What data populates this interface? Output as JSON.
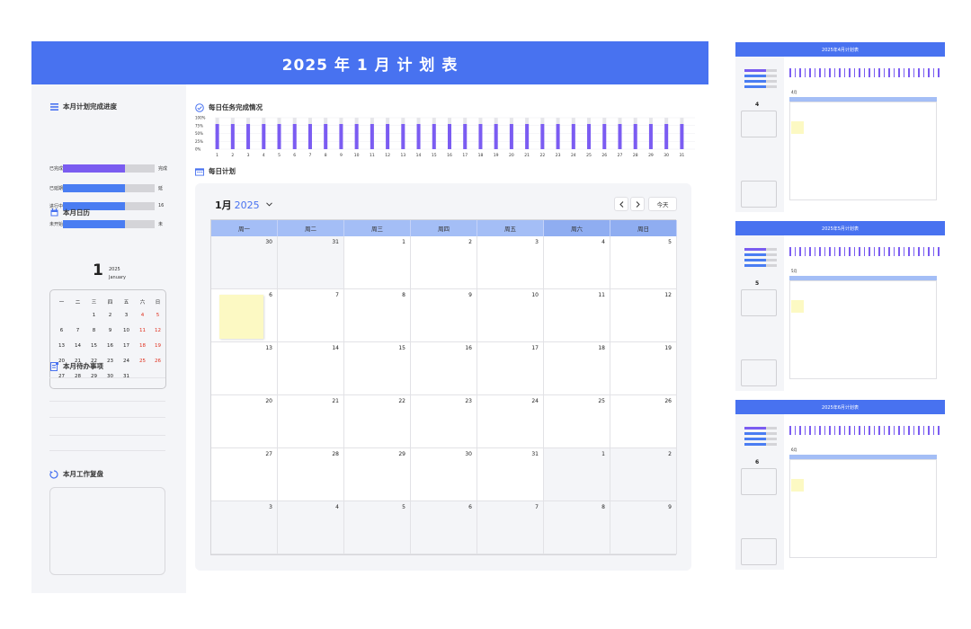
{
  "title": "2025 年 1 月 计 划 表",
  "sidebar": {
    "progress_title": "本月计划完成进度",
    "progress": [
      {
        "label": "已完成",
        "value": 0.68,
        "value_text": "完成",
        "color": "#7a5cf0"
      },
      {
        "label": "已延期",
        "value": 0.68,
        "value_text": "延",
        "color": "#4a7df2"
      },
      {
        "label": "进行中",
        "value": 0.68,
        "value_text": "16",
        "color": "#4a7df2"
      },
      {
        "label": "未开始",
        "value": 0.68,
        "value_text": "未",
        "color": "#4a7df2"
      }
    ],
    "calendar_title": "本月日历",
    "big_day": "1",
    "big_year": "2025",
    "big_month": "January",
    "weekdays": [
      "一",
      "二",
      "三",
      "四",
      "五",
      "六",
      "日"
    ],
    "weeks": [
      [
        "",
        "",
        "1",
        "2",
        "3",
        "4",
        "5"
      ],
      [
        "6",
        "7",
        "8",
        "9",
        "10",
        "11",
        "12"
      ],
      [
        "13",
        "14",
        "15",
        "16",
        "17",
        "18",
        "19"
      ],
      [
        "20",
        "21",
        "22",
        "23",
        "24",
        "25",
        "26"
      ],
      [
        "27",
        "28",
        "29",
        "30",
        "31",
        "",
        ""
      ]
    ],
    "todo_title": "本月待办事项",
    "review_title": "本月工作复盘"
  },
  "daily_chart": {
    "title": "每日任务完成情况",
    "chart_data": {
      "type": "bar",
      "categories": [
        "1",
        "2",
        "3",
        "4",
        "5",
        "6",
        "7",
        "8",
        "9",
        "10",
        "11",
        "12",
        "13",
        "14",
        "15",
        "16",
        "17",
        "18",
        "19",
        "20",
        "21",
        "22",
        "23",
        "24",
        "25",
        "26",
        "27",
        "28",
        "29",
        "30",
        "31"
      ],
      "series": [
        {
          "values": [
            0.8,
            0.8,
            0.8,
            0.8,
            0.8,
            0.8,
            0.8,
            0.8,
            0.8,
            0.8,
            0.8,
            0.8,
            0.8,
            0.8,
            0.8,
            0.8,
            0.8,
            0.8,
            0.8,
            0.8,
            0.8,
            0.8,
            0.8,
            0.8,
            0.8,
            0.8,
            0.8,
            0.8,
            0.8,
            0.8,
            0.8
          ]
        }
      ],
      "yticks": [
        "100%",
        "75%",
        "50%",
        "25%",
        "0%"
      ],
      "ylim": [
        0,
        1
      ],
      "bar_color": "#7b5cf2",
      "track_color": "#e6e6ea",
      "grid": true
    }
  },
  "daily_plan": {
    "title": "每日计划",
    "month_label": "1月",
    "year_label": "2025",
    "today_label": "今天",
    "weekday_headers": [
      "周一",
      "周二",
      "周三",
      "周四",
      "周五",
      "周六",
      "周日"
    ],
    "weeks": [
      [
        "30",
        "31",
        "1",
        "2",
        "3",
        "4",
        "5"
      ],
      [
        "6",
        "7",
        "8",
        "9",
        "10",
        "11",
        "12"
      ],
      [
        "13",
        "14",
        "15",
        "16",
        "17",
        "18",
        "19"
      ],
      [
        "20",
        "21",
        "22",
        "23",
        "24",
        "25",
        "26"
      ],
      [
        "27",
        "28",
        "29",
        "30",
        "31",
        "1",
        "2"
      ],
      [
        "3",
        "4",
        "5",
        "6",
        "7",
        "8",
        "9"
      ]
    ]
  },
  "thumbnails": [
    {
      "title": "2025年4月计划表",
      "month": "4",
      "month_label": "4月"
    },
    {
      "title": "2025年5月计划表",
      "month": "5",
      "month_label": "5月"
    },
    {
      "title": "2025年6月计划表",
      "month": "6",
      "month_label": "6月"
    }
  ],
  "colors": {
    "header": "#4872f0",
    "weekend_red": "#e0301e",
    "sticky": "#fcf9c3"
  }
}
